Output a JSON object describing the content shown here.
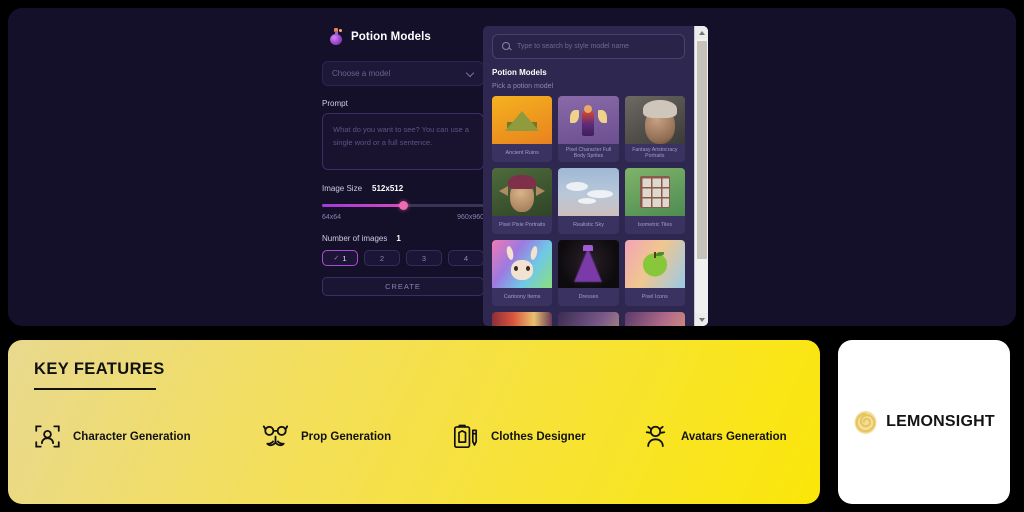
{
  "app": {
    "title": "Potion Models",
    "icon": "potion-bottle-icon",
    "model_select": {
      "value": "Choose a model",
      "chevron_icon": "chevron-down-icon"
    },
    "prompt": {
      "label": "Prompt",
      "placeholder": "What do you want to see? You can use a single word or a full sentence."
    },
    "image_size": {
      "label": "Image Size",
      "value": "512x512",
      "min_label": "64x64",
      "max_label": "960x960",
      "fill_percent": 50
    },
    "number_of_images": {
      "label": "Number of images",
      "value": "1",
      "options": [
        "1",
        "2",
        "3",
        "4"
      ],
      "selected_index": 0,
      "check_icon": "check-icon"
    },
    "create_button": "CREATE"
  },
  "modal": {
    "search": {
      "placeholder": "Type to search by style model name",
      "icon": "search-icon"
    },
    "heading": "Potion Models",
    "subtitle": "Pick a potion model",
    "cards": [
      {
        "label": "Ancient Ruins",
        "art": "t-ruins"
      },
      {
        "label": "Pixel Character Full Body Sprites",
        "art": "t-sprite"
      },
      {
        "label": "Fantasy Aristocracy Portraits",
        "art": "t-portrait"
      },
      {
        "label": "Pixel Pixie Portraits",
        "art": "t-pixie"
      },
      {
        "label": "Realistic Sky",
        "art": "t-sky"
      },
      {
        "label": "Isometric Tiles",
        "art": "t-iso"
      },
      {
        "label": "Cartoony Items",
        "art": "t-cartoon"
      },
      {
        "label": "Dresses",
        "art": "t-dress"
      },
      {
        "label": "Pixel Icons",
        "art": "t-icons"
      }
    ],
    "scrollbar": {
      "up_icon": "scroll-up-arrow-icon",
      "down_icon": "scroll-down-arrow-icon"
    }
  },
  "features": {
    "title": "KEY FEATURES",
    "items": [
      {
        "label": "Character Generation",
        "icon": "character-frame-icon"
      },
      {
        "label": "Prop Generation",
        "icon": "glasses-mustache-icon"
      },
      {
        "label": "Clothes Designer",
        "icon": "clipboard-garment-pencil-icon"
      },
      {
        "label": "Avatars Generation",
        "icon": "avatar-head-icon"
      }
    ]
  },
  "logo": {
    "text": "LEMONSIGHT",
    "mark_icon": "lemon-spiral-icon"
  },
  "colors": {
    "panel_bg": "#151029",
    "modal_bg": "#2e2750",
    "accent_pink": "#f06ab0",
    "accent_purple": "#a23bd8",
    "banner_yellow": "#f7e23a",
    "logo_yellow": "#e8c55a"
  }
}
